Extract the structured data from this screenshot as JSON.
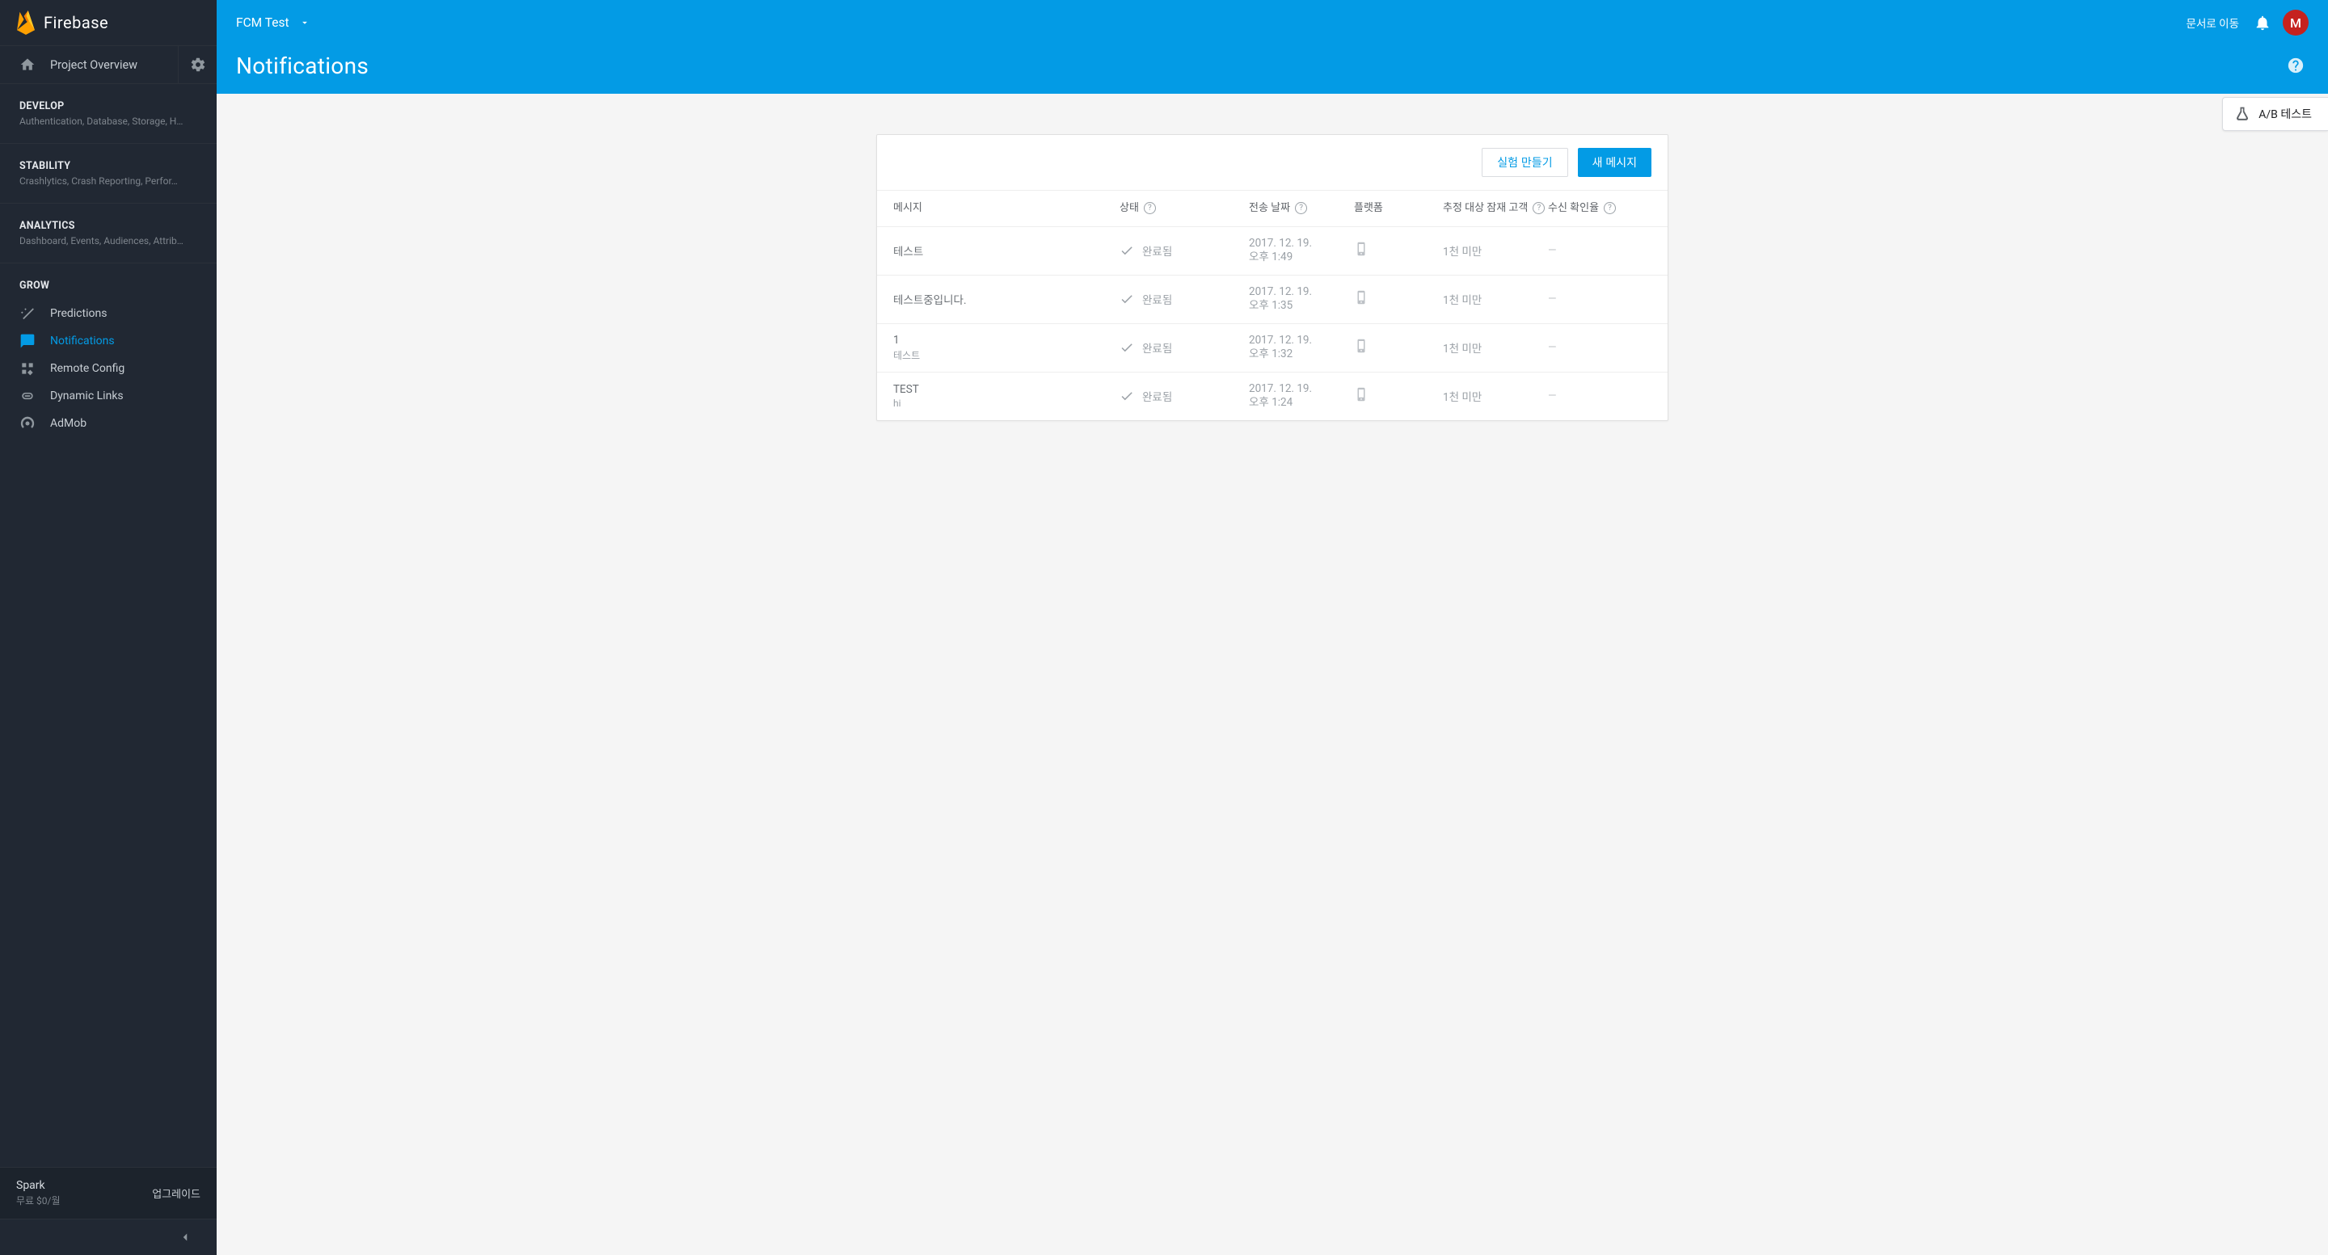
{
  "brand": "Firebase",
  "sidebar": {
    "overview": {
      "label": "Project Overview"
    },
    "sections": [
      {
        "title": "DEVELOP",
        "sub": "Authentication, Database, Storage, H…"
      },
      {
        "title": "STABILITY",
        "sub": "Crashlytics, Crash Reporting, Perfor…"
      },
      {
        "title": "ANALYTICS",
        "sub": "Dashboard, Events, Audiences, Attrib…"
      }
    ],
    "grow": {
      "title": "GROW",
      "items": [
        {
          "label": "Predictions"
        },
        {
          "label": "Notifications"
        },
        {
          "label": "Remote Config"
        },
        {
          "label": "Dynamic Links"
        },
        {
          "label": "AdMob"
        }
      ]
    },
    "plan": {
      "name": "Spark",
      "sub": "무료 $0/월",
      "upgrade": "업그레이드"
    }
  },
  "header": {
    "project": "FCM Test",
    "docs_link": "문서로 이동",
    "avatar_initial": "M",
    "page_title": "Notifications"
  },
  "ab_chip": {
    "label": "A/B 테스트"
  },
  "card": {
    "buttons": {
      "experiment": "실험 만들기",
      "new_message": "새 메시지"
    },
    "columns": {
      "message": "메시지",
      "status": "상태",
      "sent": "전송 날짜",
      "platform": "플랫폼",
      "audience": "추정 대상 잠재 고객",
      "open_rate": "수신 확인율"
    },
    "status_label": "완료됨",
    "audience_label": "1천 미만",
    "rows": [
      {
        "title": "테스트",
        "sub": "",
        "date1": "2017. 12. 19.",
        "date2": "오후 1:49"
      },
      {
        "title": "테스트중입니다.",
        "sub": "",
        "date1": "2017. 12. 19.",
        "date2": "오후 1:35"
      },
      {
        "title": "1",
        "sub": "테스트",
        "date1": "2017. 12. 19.",
        "date2": "오후 1:32"
      },
      {
        "title": "TEST",
        "sub": "hi",
        "date1": "2017. 12. 19.",
        "date2": "오후 1:24"
      }
    ]
  }
}
